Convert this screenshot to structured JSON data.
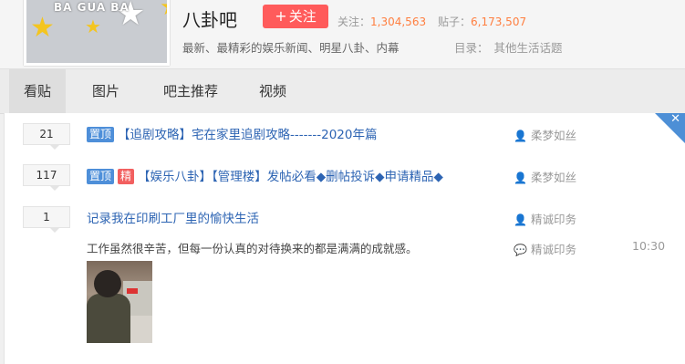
{
  "forum": {
    "logo_text": "BA GUA BA",
    "name": "八卦吧",
    "follow_label": "关注",
    "follow_plus": "+",
    "followers_label": "关注：",
    "followers": "1,304,563",
    "posts_label": "贴子：",
    "posts": "6,173,507",
    "description": "最新、最精彩的娱乐新闻、明星八卦、内幕",
    "directory_label": "目录：",
    "directory": "其他生活话题"
  },
  "tabs": [
    "看贴",
    "图片",
    "吧主推荐",
    "视频"
  ],
  "threads": [
    {
      "replies": "21",
      "badges": [
        "置顶"
      ],
      "title": "【追剧攻略】宅在家里追剧攻略-------2020年篇",
      "author": "柔梦如丝"
    },
    {
      "replies": "117",
      "badges": [
        "置顶",
        "精"
      ],
      "title": "【娱乐八卦】【管理楼】发帖必看◆删帖投诉◆申请精品◆",
      "author": "柔梦如丝"
    },
    {
      "replies": "1",
      "title": "记录我在印刷工厂里的愉快生活",
      "author": "精诚印务",
      "abstract": "工作虽然很辛苦，但每一份认真的对待换来的都是满满的成就感。",
      "last_reply_user": "精诚印务",
      "last_reply_time": "10:30"
    }
  ],
  "colors": {
    "accent": "#2d64b3",
    "follow_button": "#ff5b5b",
    "badge_top": "#4e8fd9",
    "badge_good": "#f25f5f",
    "count": "#ff7f40"
  },
  "icons": {
    "author": "user-icon",
    "last_reply": "comment-icon",
    "close": "close-icon"
  }
}
